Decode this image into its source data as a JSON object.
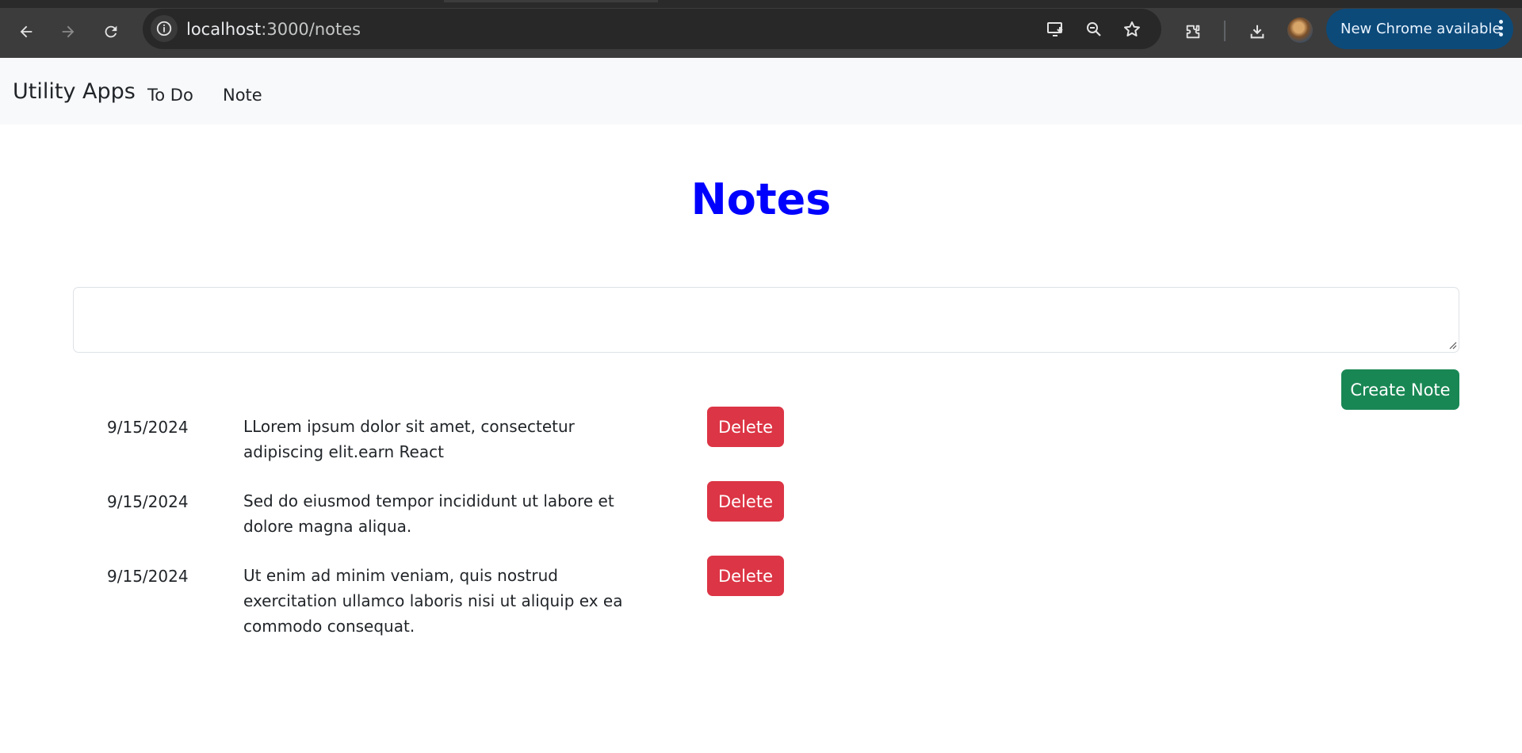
{
  "browser": {
    "url_host": "localhost",
    "url_path": ":3000/notes",
    "update_label": "New Chrome available",
    "icons": [
      "back-icon",
      "forward-icon",
      "reload-icon",
      "site-info-icon",
      "install-app-icon",
      "zoom-icon",
      "bookmark-star-icon",
      "extensions-icon",
      "downloads-icon",
      "profile-avatar",
      "more-vert-icon"
    ]
  },
  "navbar": {
    "brand": "Utility Apps",
    "links": [
      {
        "label": "To Do"
      },
      {
        "label": "Note"
      }
    ]
  },
  "page": {
    "title": "Notes",
    "input_value": "",
    "create_label": "Create Note",
    "title_color": "#0000ff",
    "create_color": "#198754",
    "delete_color": "#dc3545"
  },
  "notes": [
    {
      "date": "9/15/2024",
      "text": "LLorem ipsum dolor sit amet, consectetur adipiscing elit.earn React",
      "delete_label": "Delete"
    },
    {
      "date": "9/15/2024",
      "text": "Sed do eiusmod tempor incididunt ut labore et dolore magna aliqua.",
      "delete_label": "Delete"
    },
    {
      "date": "9/15/2024",
      "text": "Ut enim ad minim veniam, quis nostrud exercitation ullamco laboris nisi ut aliquip ex ea commodo consequat.",
      "delete_label": "Delete"
    }
  ]
}
